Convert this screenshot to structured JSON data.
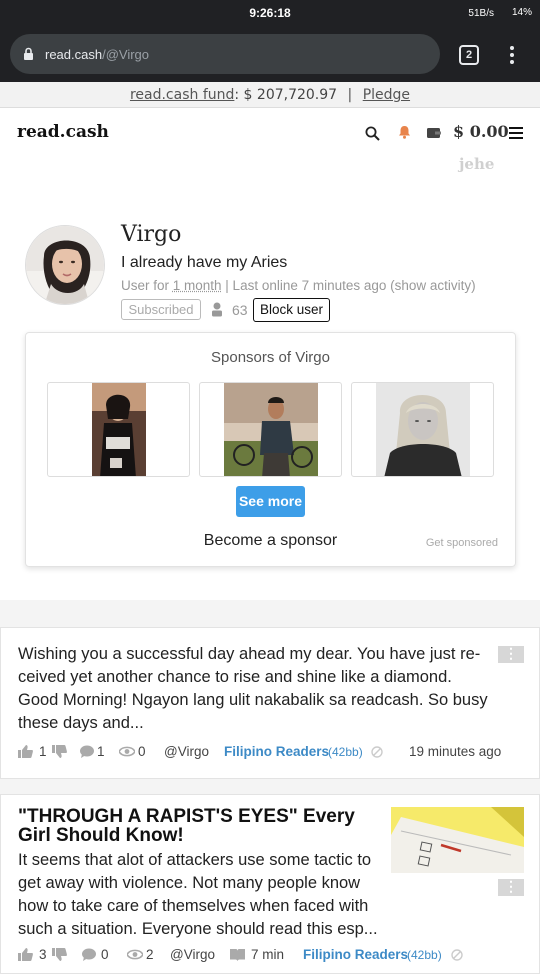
{
  "status_bar": {
    "time": "9:26:18",
    "network_speed": "51B/s",
    "battery": "14%"
  },
  "browser": {
    "url_host": "read.cash",
    "url_path": "/@Virgo",
    "tab_count": "2"
  },
  "fund_banner": {
    "link_label": "read.cash fund",
    "amount": ": $ 207,720.97",
    "separator": "|",
    "pledge_label": "Pledge"
  },
  "nav": {
    "logo": "read.cash",
    "balance": "$ 0.00",
    "username_hint": "jehe"
  },
  "profile": {
    "name": "Virgo",
    "bio": "I already have my Aries",
    "meta_prefix": "User for ",
    "meta_duration": "1 month",
    "meta_suffix": " | Last online 7 minutes ago (show activity)",
    "subscribe_label": "Subscribed",
    "subscriber_count": "63",
    "block_label": "Block user"
  },
  "sponsors": {
    "title": "Sponsors of Virgo",
    "see_more": "See more",
    "become_sponsor": "Become a sponsor",
    "get_sponsored": "Get sponsored"
  },
  "posts": [
    {
      "text": "Wishing you a successful day ahead my dear. You have just re-ceived yet another chance to rise and shine like a diamond. Good Morning! Ngayon lang ulit nakabalik sa readcash. So busy these days and...",
      "likes": "1",
      "comments": "1",
      "views": "0",
      "author": "@Virgo",
      "community": "Filipino Readers",
      "community_bb": "(42bb)",
      "time": "19 minutes ago"
    },
    {
      "title": "\"THROUGH A RAPIST'S EYES\" Every Girl Should Know!",
      "text": "It seems that alot of attackers use some tactic to get away with violence. Not many people know how to take care of themselves when faced with such a situation. Everyone should read this esp...",
      "likes": "3",
      "comments": "0",
      "views": "2",
      "author": "@Virgo",
      "read_time": "7 min",
      "community": "Filipino Readers",
      "community_bb": "(42bb)"
    }
  ]
}
